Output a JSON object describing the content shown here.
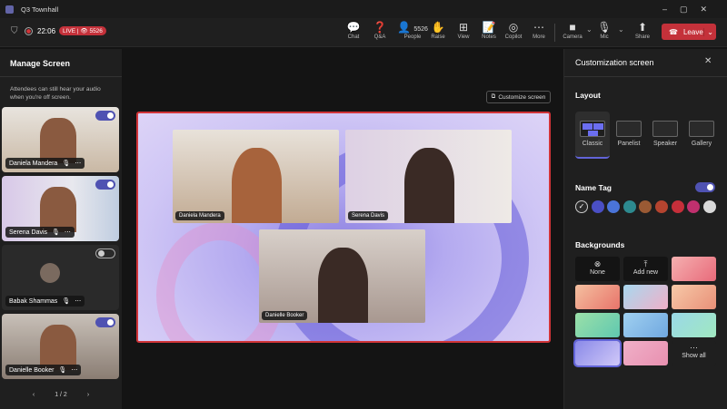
{
  "window": {
    "title": "Q3 Townhall"
  },
  "status": {
    "time": "22:06",
    "live": "LIVE",
    "viewers": "5526"
  },
  "toolbar": [
    {
      "label": "Chat",
      "icon": "chat-icon",
      "glyph": "💬"
    },
    {
      "label": "Q&A",
      "icon": "qa-icon",
      "glyph": "❓"
    },
    {
      "label": "People",
      "icon": "people-icon",
      "glyph": "👤",
      "count": "5526"
    },
    {
      "label": "Raise",
      "icon": "raise-hand-icon",
      "glyph": "✋"
    },
    {
      "label": "View",
      "icon": "view-icon",
      "glyph": "⊞"
    },
    {
      "label": "Notes",
      "icon": "notes-icon",
      "glyph": "📝"
    },
    {
      "label": "Copilot",
      "icon": "copilot-icon",
      "glyph": "◎"
    },
    {
      "label": "More",
      "icon": "more-icon",
      "glyph": "⋯"
    },
    {
      "label": "Camera",
      "icon": "camera-icon",
      "glyph": "■"
    },
    {
      "label": "Mic",
      "icon": "mic-icon",
      "glyph": "🎙"
    },
    {
      "label": "Share",
      "icon": "share-icon",
      "glyph": "⬆"
    }
  ],
  "leave_label": "Leave",
  "left": {
    "title": "Manage Screen",
    "note": "Attendees can still hear your audio when you're off screen.",
    "tiles": [
      {
        "name": "Daniela Mandera",
        "on": true
      },
      {
        "name": "Serena Davis",
        "on": true
      },
      {
        "name": "Babak Shammas",
        "on": false
      },
      {
        "name": "Danielle Booker",
        "on": true
      }
    ],
    "pager": "1 / 2"
  },
  "stage": {
    "customize_label": "Customize screen",
    "videos": [
      "Daniela Mandera",
      "Serena Davis",
      "Danielle Booker"
    ]
  },
  "right": {
    "title": "Customization screen",
    "layout_label": "Layout",
    "layouts": [
      "Classic",
      "Panelist",
      "Speaker",
      "Gallery"
    ],
    "nametag_label": "Name Tag",
    "colors": [
      "#2a2a2a",
      "#4a4fc4",
      "#4a74d9",
      "#2d8a8f",
      "#9a5a34",
      "#b5442f",
      "#c62f3a",
      "#c0306e",
      "#d9d9d9"
    ],
    "backgrounds_label": "Backgrounds",
    "none_label": "None",
    "add_label": "Add new",
    "show_all": "Show all"
  }
}
